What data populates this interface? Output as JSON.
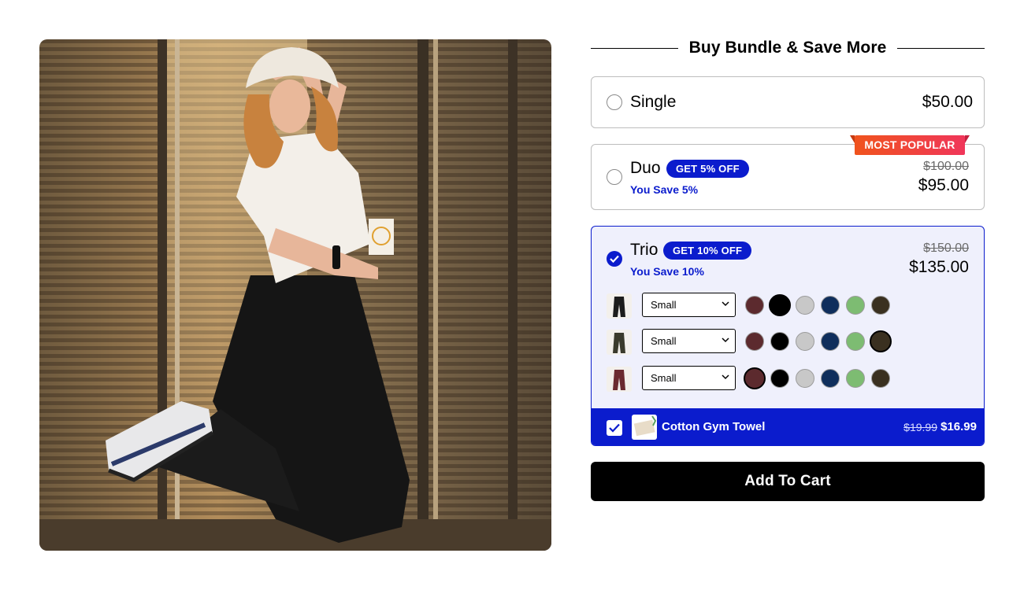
{
  "product_image": {
    "alt": ""
  },
  "bundle": {
    "heading": "Buy Bundle & Save More",
    "options": {
      "single": {
        "label": "Single",
        "price": "$50.00",
        "selected": false
      },
      "duo": {
        "label": "Duo",
        "badge": "GET 5% OFF",
        "save_text": "You Save 5%",
        "price_old": "$100.00",
        "price": "$95.00",
        "ribbon": "MOST POPULAR",
        "selected": false
      },
      "trio": {
        "label": "Trio",
        "badge": "GET 10% OFF",
        "save_text": "You Save 10%",
        "price_old": "$150.00",
        "price": "$135.00",
        "selected": true,
        "variants": [
          {
            "size": "Small",
            "selected_color_index": 1
          },
          {
            "size": "Small",
            "selected_color_index": 5
          },
          {
            "size": "Small",
            "selected_color_index": 0
          }
        ]
      }
    },
    "swatch_colors": [
      "#5c2a2e",
      "#000000",
      "#c8c8c8",
      "#0f2e5c",
      "#7dbc72",
      "#3a3020"
    ],
    "addon": {
      "checked": true,
      "name": "Cotton Gym Towel",
      "price_old": "$19.99",
      "price": "$16.99"
    },
    "cta": "Add To Cart"
  },
  "colors": {
    "accent": "#0b1ccd",
    "ribbon": "#f0453a",
    "cta_bg": "#000000"
  },
  "icons": {
    "check": "checkmark-icon",
    "chevron": "chevron-down-icon"
  }
}
